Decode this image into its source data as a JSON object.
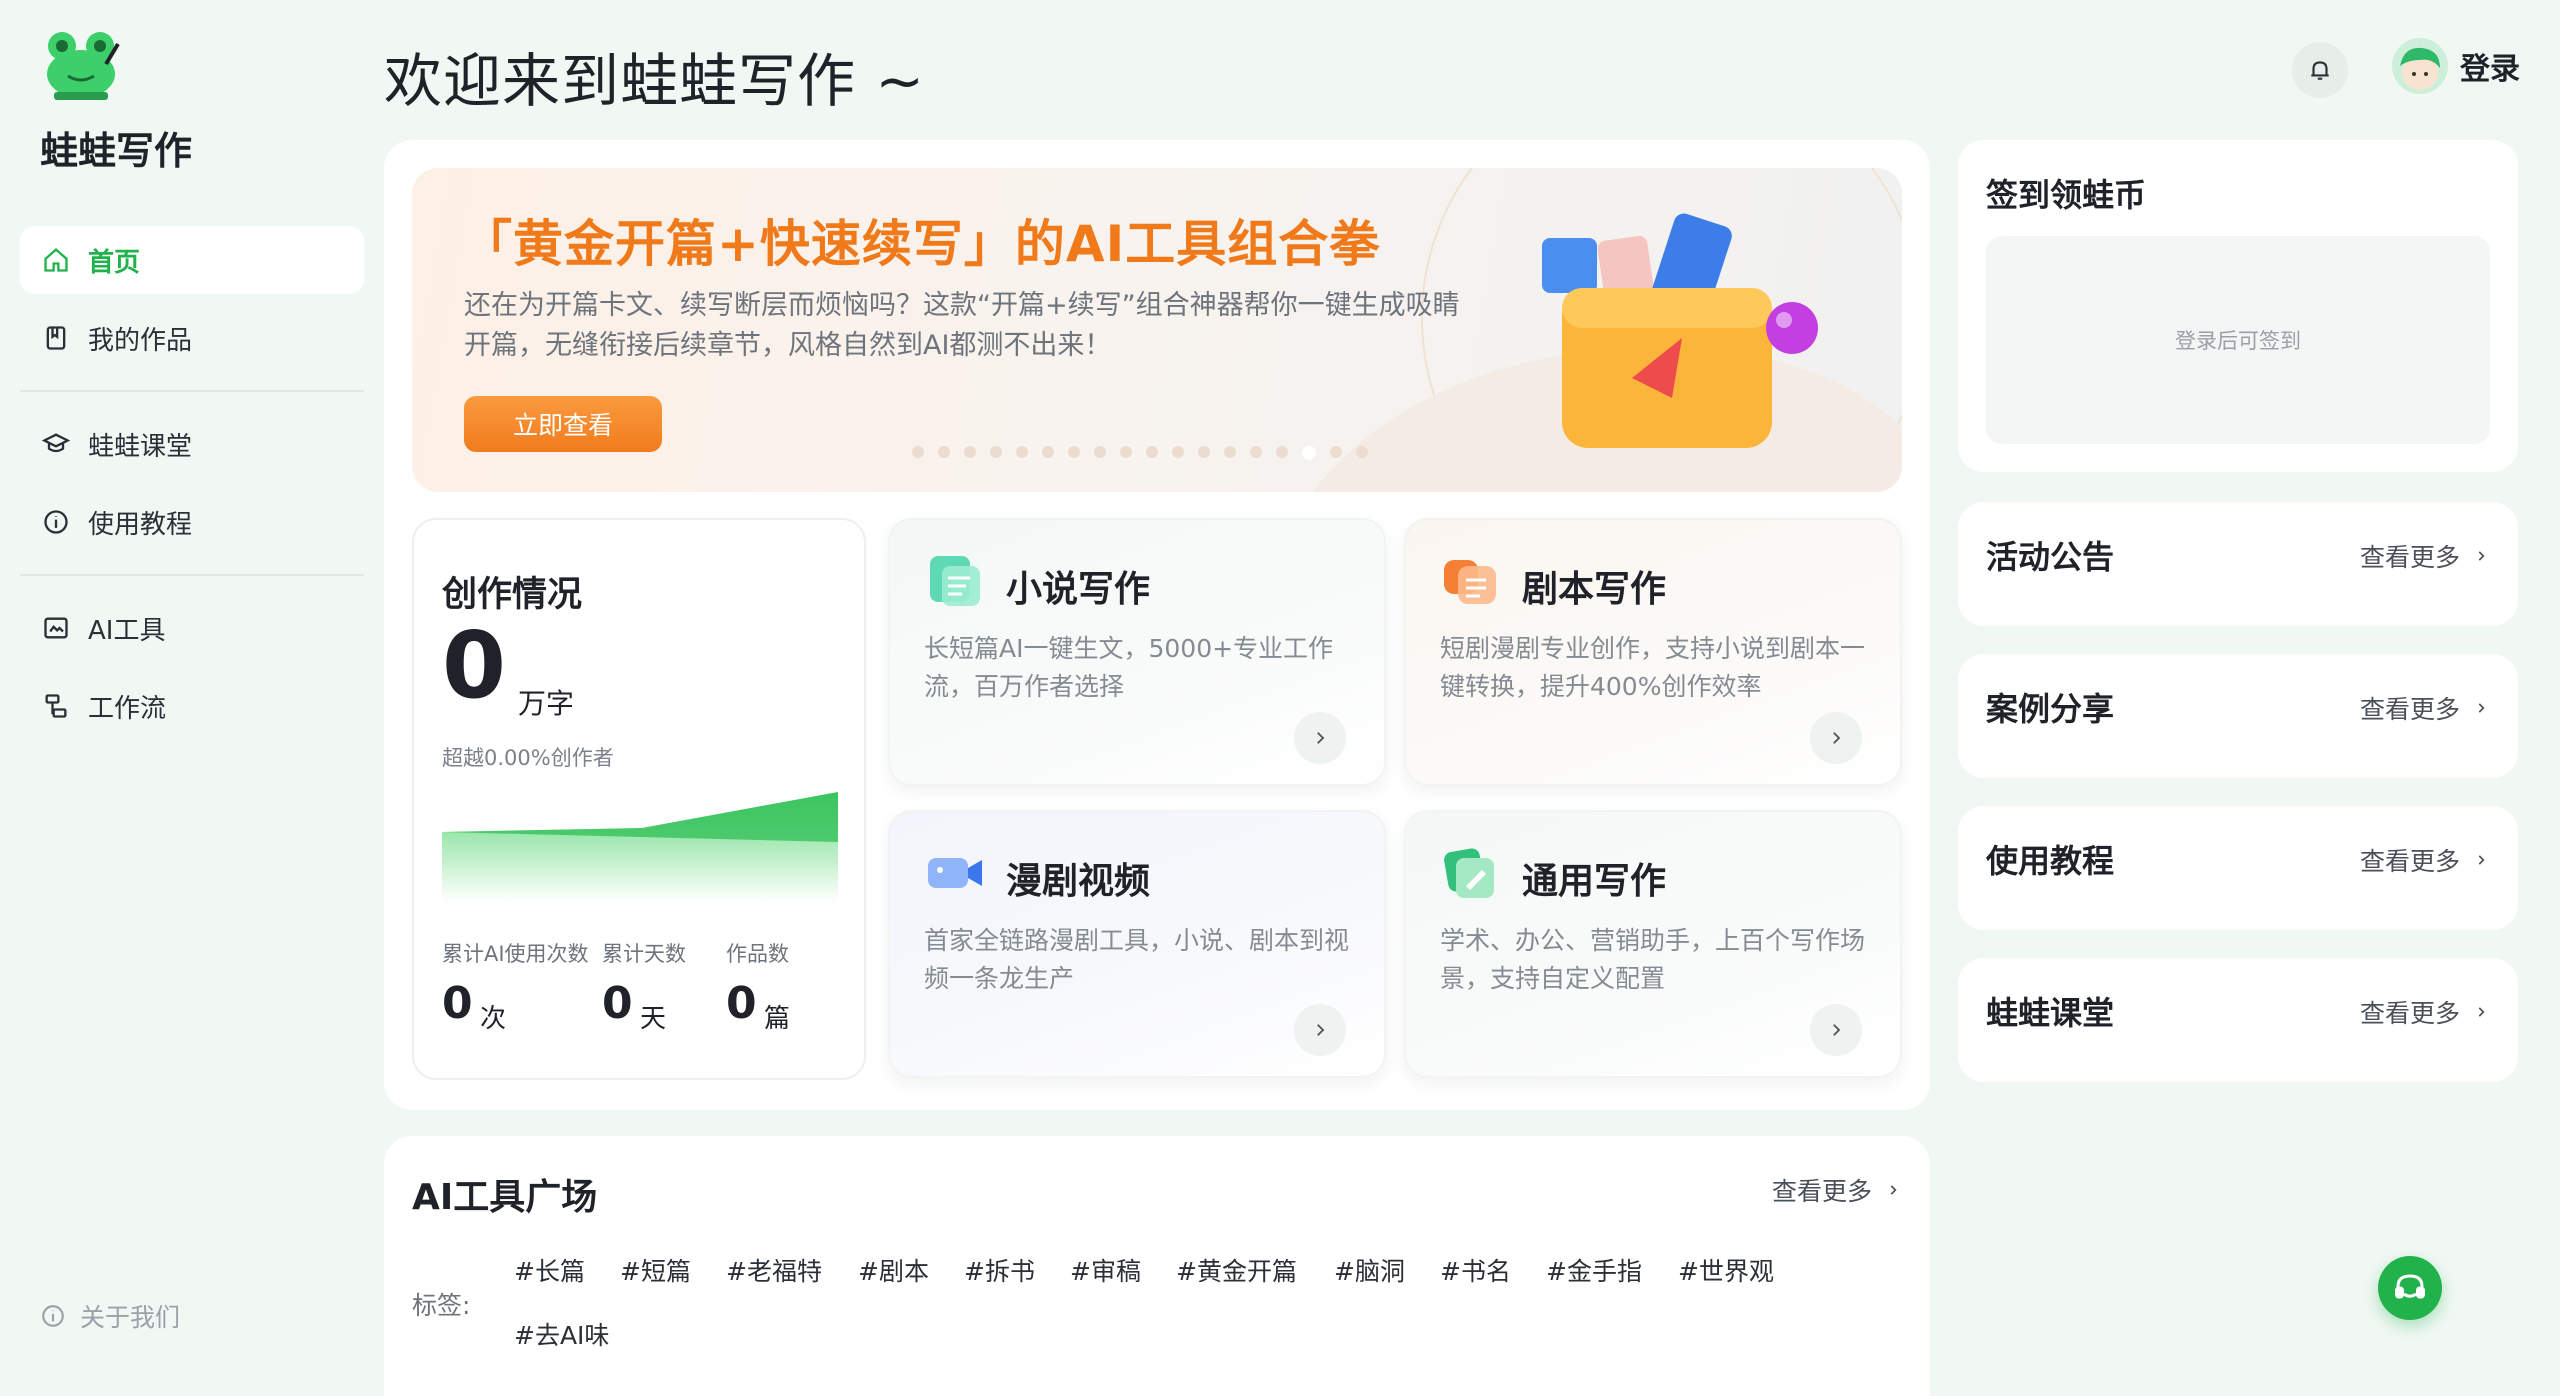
{
  "sidebar": {
    "brand": "蛙蛙写作",
    "items": [
      {
        "label": "首页",
        "icon": "home-icon",
        "active": true
      },
      {
        "label": "我的作品",
        "icon": "book-icon"
      },
      {
        "label": "蛙蛙课堂",
        "icon": "graduation-cap-icon"
      },
      {
        "label": "使用教程",
        "icon": "info-circle-icon"
      },
      {
        "label": "AI工具",
        "icon": "ai-image-icon"
      },
      {
        "label": "工作流",
        "icon": "workflow-icon"
      }
    ],
    "about": "关于我们"
  },
  "header": {
    "welcome": "欢迎来到蛙蛙写作 ~",
    "login": "登录"
  },
  "banner": {
    "title": "「黄金开篇+快速续写」的AI工具组合拳",
    "desc": "还在为开篇卡文、续写断层而烦恼吗？这款“开篇+续写”组合神器帮你一键生成吸睛开篇，无缝衔接后续章节，风格自然到AI都测不出来！",
    "button": "立即查看"
  },
  "stats": {
    "title": "创作情况",
    "words": "0",
    "words_unit": "万字",
    "surpass": "超越0.00%创作者",
    "items": [
      {
        "label": "累计AI使用次数",
        "value": "0",
        "unit": "次"
      },
      {
        "label": "累计天数",
        "value": "0",
        "unit": "天"
      },
      {
        "label": "作品数",
        "value": "0",
        "unit": "篇"
      }
    ]
  },
  "features": [
    {
      "title": "小说写作",
      "desc": "长短篇AI一键生文，5000+专业工作流，百万作者选择",
      "icon": "novel-icon"
    },
    {
      "title": "剧本写作",
      "desc": "短剧漫剧专业创作，支持小说到剧本一键转换，提升400%创作效率",
      "icon": "script-icon"
    },
    {
      "title": "漫剧视频",
      "desc": "首家全链路漫剧工具，小说、剧本到视频一条龙生产",
      "icon": "video-icon"
    },
    {
      "title": "通用写作",
      "desc": "学术、办公、营销助手，上百个写作场景，支持自定义配置",
      "icon": "general-write-icon"
    }
  ],
  "right": {
    "signin_title": "签到领蛙币",
    "signin_hint": "登录后可签到",
    "more": "查看更多",
    "sections": [
      "活动公告",
      "案例分享",
      "使用教程",
      "蛙蛙课堂"
    ]
  },
  "tools": {
    "title": "AI工具广场",
    "more": "查看更多",
    "tag_label": "标签:",
    "tags": [
      "#长篇",
      "#短篇",
      "#老福特",
      "#剧本",
      "#拆书",
      "#审稿",
      "#黄金开篇",
      "#脑洞",
      "#书名",
      "#金手指",
      "#世界观",
      "#去AI味"
    ]
  },
  "colors": {
    "accent": "#21b34b",
    "banner_title": "#f07a1a",
    "background": "#f1f8f4"
  }
}
